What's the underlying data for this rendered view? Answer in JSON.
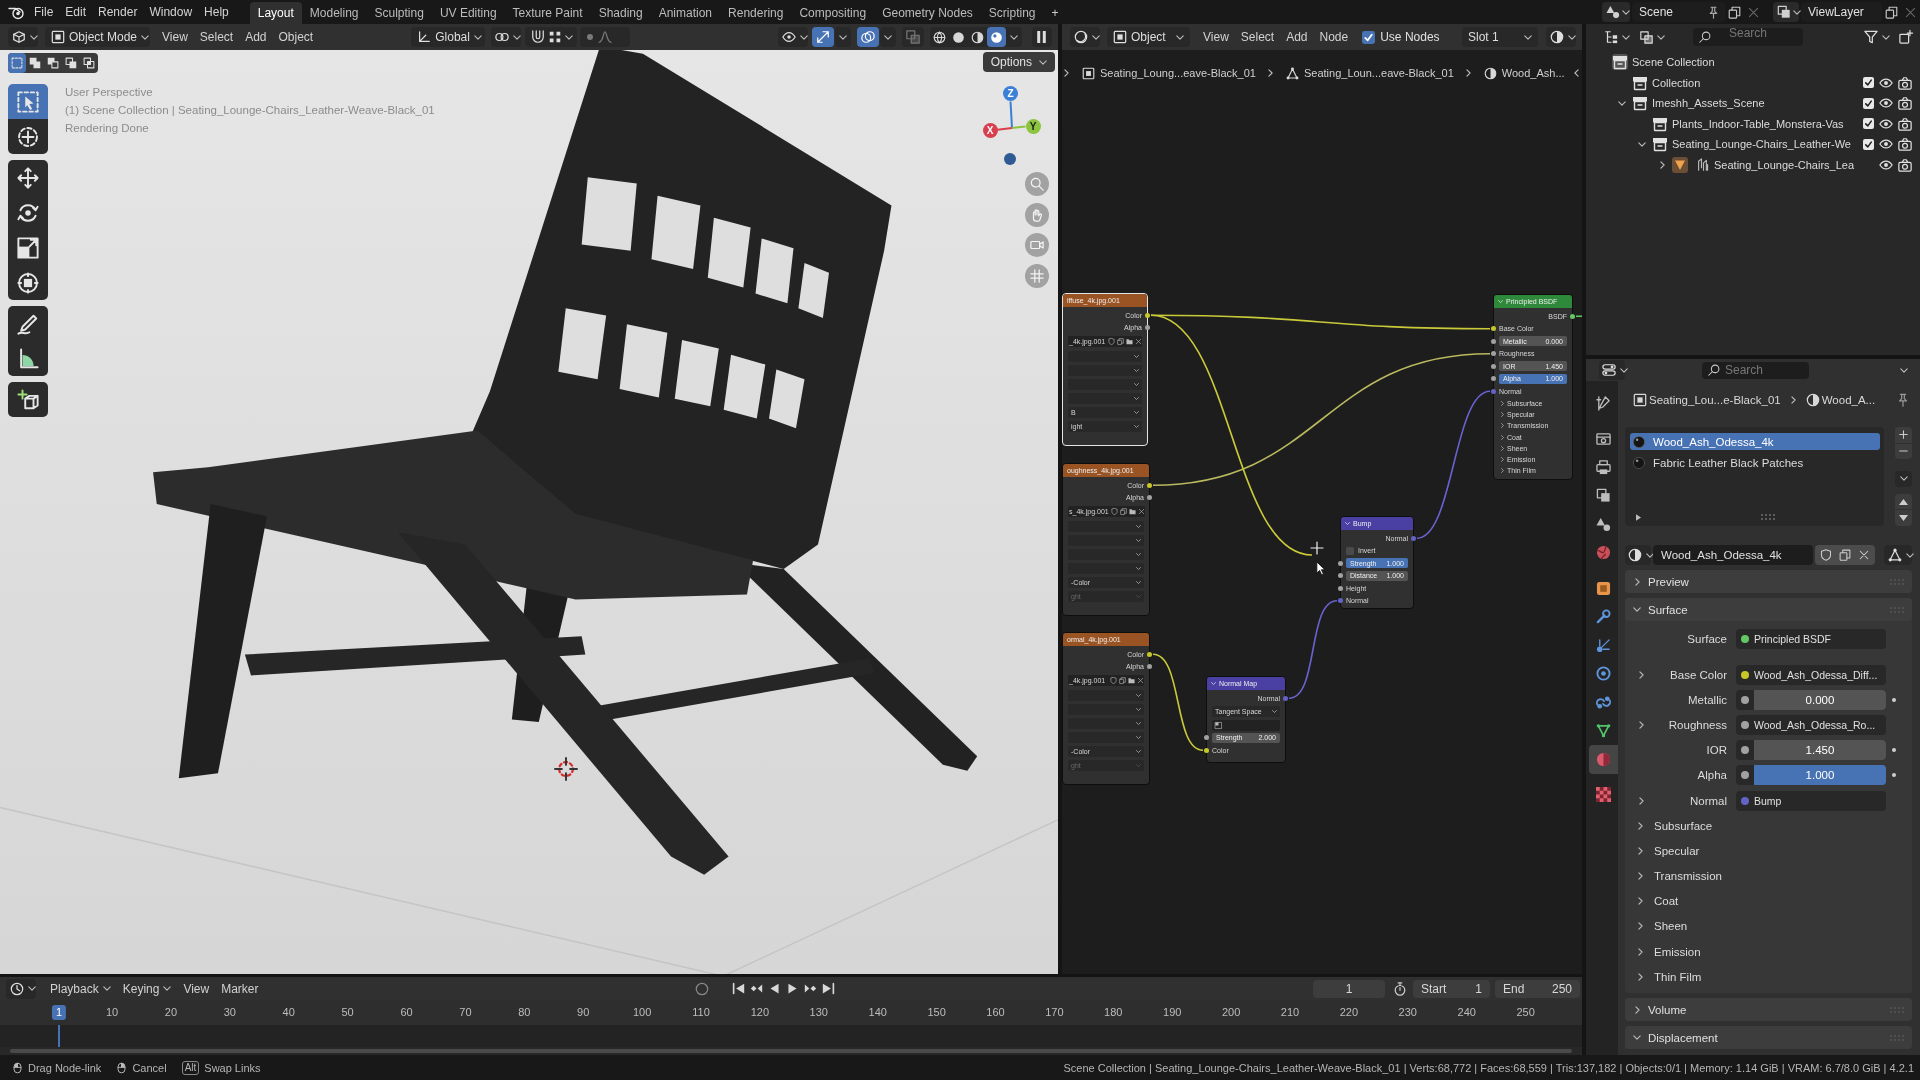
{
  "top_bar": {
    "menus": [
      "File",
      "Edit",
      "Render",
      "Window",
      "Help"
    ],
    "workspaces": [
      {
        "label": "Layout",
        "selected": true
      },
      {
        "label": "Modeling",
        "selected": false
      },
      {
        "label": "Sculpting",
        "selected": false
      },
      {
        "label": "UV Editing",
        "selected": false
      },
      {
        "label": "Texture Paint",
        "selected": false
      },
      {
        "label": "Shading",
        "selected": false
      },
      {
        "label": "Animation",
        "selected": false
      },
      {
        "label": "Rendering",
        "selected": false
      },
      {
        "label": "Compositing",
        "selected": false
      },
      {
        "label": "Geometry Nodes",
        "selected": false
      },
      {
        "label": "Scripting",
        "selected": false
      }
    ],
    "add_workspace": "+",
    "scene": "Scene",
    "view_layer": "ViewLayer"
  },
  "viewport": {
    "header": {
      "mode": "Object Mode",
      "menus": [
        "View",
        "Select",
        "Add",
        "Object"
      ],
      "orientation": "Global",
      "toggles": [
        {
          "kind": "gizmo",
          "on": true
        },
        {
          "kind": "overlay",
          "on": true
        },
        {
          "kind": "xray",
          "on": false
        }
      ],
      "shading_modes": [
        {
          "kind": "wireframe",
          "selected": false
        },
        {
          "kind": "solid",
          "selected": false
        },
        {
          "kind": "material",
          "selected": false
        },
        {
          "kind": "rendered",
          "selected": true
        }
      ]
    },
    "select_modes": [
      {
        "kind": "set",
        "selected": true
      },
      {
        "kind": "extend",
        "selected": false
      },
      {
        "kind": "subtract",
        "selected": false
      },
      {
        "kind": "invert",
        "selected": false
      },
      {
        "kind": "intersect",
        "selected": false
      }
    ],
    "options": "Options",
    "overlay_lines": [
      "User Perspective",
      "(1) Scene Collection | Seating_Lounge-Chairs_Leather-Weave-Black_01",
      "Rendering Done"
    ],
    "tool_groups": [
      [
        {
          "kind": "select_box",
          "selected": true
        },
        {
          "kind": "cursor",
          "selected": false
        }
      ],
      [
        {
          "kind": "move",
          "selected": false
        },
        {
          "kind": "rotate",
          "selected": false
        },
        {
          "kind": "scale",
          "selected": false
        },
        {
          "kind": "transform",
          "selected": false
        }
      ],
      [
        {
          "kind": "annotate",
          "selected": false
        },
        {
          "kind": "measure",
          "selected": false
        }
      ],
      [
        {
          "kind": "add_cube",
          "selected": false
        }
      ]
    ],
    "gizmo_axes": [
      {
        "kind": "z",
        "label": "Z"
      },
      {
        "kind": "x",
        "label": "X"
      },
      {
        "kind": "y",
        "label": "Y"
      }
    ]
  },
  "node_editor": {
    "header": {
      "type": "Object",
      "menus": [
        "View",
        "Select",
        "Add",
        "Node"
      ],
      "use_nodes": {
        "label": "Use Nodes",
        "checked": true
      },
      "slot": "Slot 1"
    },
    "breadcrumbs": [
      {
        "kind": "object",
        "label": "Seating_Loung...eave-Black_01"
      },
      {
        "kind": "mesh",
        "label": "Seating_Loun...eave-Black_01"
      },
      {
        "kind": "material",
        "label": "Wood_Ash..."
      }
    ],
    "nodes": [
      {
        "kind": "image_texture",
        "title": "iffuse_4k.jpg.001",
        "selected": true,
        "rows": [
          {
            "kind": "output",
            "label": "Color",
            "color": "#c7c729"
          },
          {
            "kind": "output",
            "label": "Alpha",
            "color": "#a1a1a1"
          },
          {
            "kind": "image",
            "label": "_4k.jpg.001"
          },
          {
            "kind": "dropdown",
            "disabled": false
          },
          {
            "kind": "dropdown",
            "disabled": false
          },
          {
            "kind": "dropdown",
            "disabled": false
          },
          {
            "kind": "dropdown",
            "disabled": false
          },
          {
            "kind": "dropdown",
            "label": "B",
            "disabled": false
          },
          {
            "kind": "dropdown",
            "label": "ight",
            "disabled": false
          }
        ]
      },
      {
        "kind": "image_texture",
        "title": "oughness_4k.jpg.001",
        "selected": false,
        "rows": [
          {
            "kind": "output",
            "label": "Color",
            "color": "#c7c729"
          },
          {
            "kind": "output",
            "label": "Alpha",
            "color": "#a1a1a1"
          },
          {
            "kind": "image",
            "label": "s_4k.jpg.001"
          },
          {
            "kind": "dropdown",
            "disabled": false
          },
          {
            "kind": "dropdown",
            "disabled": false
          },
          {
            "kind": "dropdown",
            "disabled": false
          },
          {
            "kind": "dropdown",
            "disabled": false
          },
          {
            "kind": "dropdown",
            "label": "-Color",
            "disabled": false
          },
          {
            "kind": "dropdown",
            "label": "ght",
            "disabled": true
          }
        ]
      },
      {
        "kind": "image_texture",
        "title": "ormal_4k.jpg.001",
        "selected": false,
        "rows": [
          {
            "kind": "output",
            "label": "Color",
            "color": "#c7c729"
          },
          {
            "kind": "output",
            "label": "Alpha",
            "color": "#a1a1a1"
          },
          {
            "kind": "image",
            "label": "_4k.jpg.001"
          },
          {
            "kind": "dropdown",
            "disabled": false
          },
          {
            "kind": "dropdown",
            "disabled": false
          },
          {
            "kind": "dropdown",
            "disabled": false
          },
          {
            "kind": "dropdown",
            "disabled": false
          },
          {
            "kind": "dropdown",
            "label": "-Color",
            "disabled": false
          },
          {
            "kind": "dropdown",
            "label": "ght",
            "disabled": true
          }
        ]
      },
      {
        "kind": "principled",
        "title": "Principled BSDF",
        "selected": false,
        "rows": [
          {
            "kind": "output",
            "label": "BSDF",
            "color": "#63c763"
          },
          {
            "kind": "input",
            "label": "Base Color",
            "color": "#c7c729"
          },
          {
            "kind": "number",
            "label": "Metallic",
            "value": "0.000",
            "color": "#a1a1a1"
          },
          {
            "kind": "input",
            "label": "Roughness",
            "color": "#a1a1a1"
          },
          {
            "kind": "number",
            "label": "IOR",
            "value": "1.450",
            "color": "#a1a1a1"
          },
          {
            "kind": "slider",
            "label": "Alpha",
            "value": "1.000",
            "level": 1,
            "color": "#a1a1a1"
          },
          {
            "kind": "input",
            "label": "Normal",
            "color": "#6363c7"
          },
          {
            "kind": "panel",
            "label": "Subsurface"
          },
          {
            "kind": "panel",
            "label": "Specular"
          },
          {
            "kind": "panel",
            "label": "Transmission"
          },
          {
            "kind": "panel",
            "label": "Coat"
          },
          {
            "kind": "panel",
            "label": "Sheen"
          },
          {
            "kind": "panel",
            "label": "Emission"
          },
          {
            "kind": "panel",
            "label": "Thin Film"
          }
        ]
      },
      {
        "kind": "bump",
        "title": "Bump",
        "selected": false,
        "rows": [
          {
            "kind": "output",
            "label": "Normal",
            "color": "#6363c7"
          },
          {
            "kind": "checkbox",
            "label": "Invert",
            "checked": false
          },
          {
            "kind": "slider",
            "label": "Strength",
            "value": "1.000",
            "level": 1,
            "color": "#a1a1a1"
          },
          {
            "kind": "number",
            "label": "Distance",
            "value": "1.000",
            "color": "#a1a1a1"
          },
          {
            "kind": "input",
            "label": "Height",
            "color": "#a1a1a1"
          },
          {
            "kind": "input",
            "label": "Normal",
            "color": "#6363c7"
          }
        ]
      },
      {
        "kind": "normal_map",
        "title": "Normal Map",
        "selected": false,
        "rows": [
          {
            "kind": "output",
            "label": "Normal",
            "color": "#6363c7"
          },
          {
            "kind": "dropdown",
            "label": "Tangent Space",
            "disabled": false
          },
          {
            "kind": "field"
          },
          {
            "kind": "number",
            "label": "Strength",
            "value": "2.000",
            "color": "#a1a1a1"
          },
          {
            "kind": "input",
            "label": "Color",
            "color": "#c7c729"
          }
        ]
      }
    ]
  },
  "outliner": {
    "search_placeholder": "Search",
    "tree": [
      {
        "kind": "scene_collection",
        "label": "Scene Collection",
        "children": [
          {
            "kind": "collection",
            "label": "Collection",
            "checked": true
          },
          {
            "kind": "collection",
            "label": "Imeshh_Assets_Scene",
            "checked": true,
            "expanded": true,
            "children": [
              {
                "kind": "collection",
                "label": "Plants_Indoor-Table_Monstera-Vas",
                "checked": true
              },
              {
                "kind": "collection",
                "label": "Seating_Lounge-Chairs_Leather-We",
                "checked": true,
                "expanded": true,
                "children": [
                  {
                    "kind": "object",
                    "label": "Seating_Lounge-Chairs_Lea",
                    "expanded": false
                  }
                ]
              }
            ]
          }
        ]
      }
    ]
  },
  "properties": {
    "search_placeholder": "Search",
    "tabs": [
      {
        "kind": "tool",
        "selected": false
      },
      {
        "kind": "render",
        "selected": false
      },
      {
        "kind": "output",
        "selected": false
      },
      {
        "kind": "view_layer",
        "selected": false
      },
      {
        "kind": "scene",
        "selected": false
      },
      {
        "kind": "world",
        "selected": false
      },
      {
        "kind": "object",
        "selected": false
      },
      {
        "kind": "modifiers",
        "selected": false
      },
      {
        "kind": "particles",
        "selected": false
      },
      {
        "kind": "physics",
        "selected": false
      },
      {
        "kind": "constraints",
        "selected": false
      },
      {
        "kind": "data",
        "selected": false
      },
      {
        "kind": "material",
        "selected": true
      },
      {
        "kind": "texture",
        "selected": false
      }
    ],
    "breadcrumbs": [
      {
        "kind": "object",
        "label": "Seating_Lou...e-Black_01"
      },
      {
        "kind": "material",
        "label": "Wood_A..."
      }
    ],
    "material_slots": [
      {
        "label": "Wood_Ash_Odessa_4k",
        "selected": true
      },
      {
        "label": "Fabric Leather Black Patches",
        "selected": false
      }
    ],
    "material_name": "Wood_Ash_Odessa_4k",
    "panels": [
      {
        "label": "Preview",
        "expanded": false
      },
      {
        "label": "Surface",
        "expanded": true,
        "rows": [
          {
            "kind": "link",
            "label": "Surface",
            "value": "Principled BSDF",
            "color": "#63c763"
          },
          {
            "kind": "link",
            "label": "Base Color",
            "value": "Wood_Ash_Odessa_Diff...",
            "color": "#c7c729",
            "expanded": false
          },
          {
            "kind": "slider",
            "label": "Metallic",
            "value": "0.000",
            "level": 0,
            "color": "#a1a1a1"
          },
          {
            "kind": "link",
            "label": "Roughness",
            "value": "Wood_Ash_Odessa_Ro...",
            "color": "#a1a1a1",
            "expanded": false
          },
          {
            "kind": "number",
            "label": "IOR",
            "value": "1.450",
            "color": "#a1a1a1"
          },
          {
            "kind": "slider",
            "label": "Alpha",
            "value": "1.000",
            "level": 1,
            "color": "#a1a1a1"
          },
          {
            "kind": "link",
            "label": "Normal",
            "value": "Bump",
            "color": "#6363c7",
            "expanded": false
          },
          {
            "kind": "subpanel",
            "label": "Subsurface",
            "expanded": false
          },
          {
            "kind": "subpanel",
            "label": "Specular",
            "expanded": false
          },
          {
            "kind": "subpanel",
            "label": "Transmission",
            "expanded": false
          },
          {
            "kind": "subpanel",
            "label": "Coat",
            "expanded": false
          },
          {
            "kind": "subpanel",
            "label": "Sheen",
            "expanded": false
          },
          {
            "kind": "subpanel",
            "label": "Emission",
            "expanded": false
          },
          {
            "kind": "subpanel",
            "label": "Thin Film",
            "expanded": false
          }
        ]
      },
      {
        "label": "Volume",
        "expanded": false
      },
      {
        "label": "Displacement",
        "expanded": true
      }
    ]
  },
  "timeline": {
    "menus": [
      {
        "kind": "dropdown",
        "label": "Playback"
      },
      {
        "kind": "dropdown",
        "label": "Keying"
      },
      {
        "kind": "menu",
        "label": "View"
      },
      {
        "kind": "menu",
        "label": "Marker"
      }
    ],
    "current_frame": "1",
    "start_label": "Start",
    "start": "1",
    "end_label": "End",
    "end": "250",
    "ruler": [
      {
        "label": "1",
        "selected": true
      },
      {
        "label": "10",
        "selected": false
      },
      {
        "label": "20",
        "selected": false
      },
      {
        "label": "30",
        "selected": false
      },
      {
        "label": "40",
        "selected": false
      },
      {
        "label": "50",
        "selected": false
      },
      {
        "label": "60",
        "selected": false
      },
      {
        "label": "70",
        "selected": false
      },
      {
        "label": "80",
        "selected": false
      },
      {
        "label": "90",
        "selected": false
      },
      {
        "label": "100",
        "selected": false
      },
      {
        "label": "110",
        "selected": false
      },
      {
        "label": "120",
        "selected": false
      },
      {
        "label": "130",
        "selected": false
      },
      {
        "label": "140",
        "selected": false
      },
      {
        "label": "150",
        "selected": false
      },
      {
        "label": "160",
        "selected": false
      },
      {
        "label": "170",
        "selected": false
      },
      {
        "label": "180",
        "selected": false
      },
      {
        "label": "190",
        "selected": false
      },
      {
        "label": "200",
        "selected": false
      },
      {
        "label": "210",
        "selected": false
      },
      {
        "label": "220",
        "selected": false
      },
      {
        "label": "230",
        "selected": false
      },
      {
        "label": "240",
        "selected": false
      },
      {
        "label": "250",
        "selected": false
      }
    ]
  },
  "status_bar": {
    "hints": [
      {
        "kind": "mouse_left",
        "label": "Drag Node-link"
      },
      {
        "kind": "mouse_right",
        "label": "Cancel"
      },
      {
        "kind": "key",
        "key": "Alt",
        "label": "Swap Links"
      }
    ],
    "stats": "Scene Collection | Seating_Lounge-Chairs_Leather-Weave-Black_01 | Verts:68,772 | Faces:68,559 | Tris:137,182 | Objects:0/1 | Memory: 1.14 GiB | VRAM: 6.7/8.0 GiB | 4.2.1"
  }
}
